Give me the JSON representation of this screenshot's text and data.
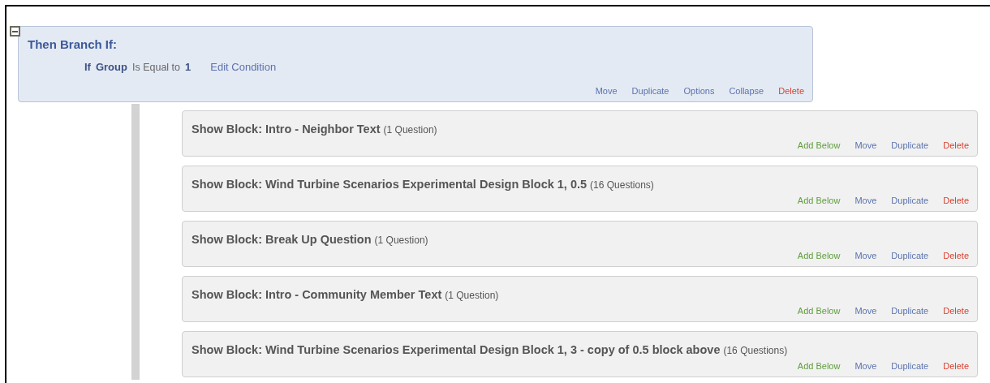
{
  "branch": {
    "expanded": true,
    "title": "Then Branch If:",
    "condition": {
      "keyword": "If",
      "field": "Group",
      "operator": "Is Equal to",
      "value": "1",
      "edit": "Edit Condition"
    },
    "actions": [
      {
        "label": "Move",
        "kind": "link"
      },
      {
        "label": "Duplicate",
        "kind": "link"
      },
      {
        "label": "Options",
        "kind": "link"
      },
      {
        "label": "Collapse",
        "kind": "link"
      },
      {
        "label": "Delete",
        "kind": "delete"
      }
    ]
  },
  "blocks": [
    {
      "title": "Show Block: Intro - Neighbor Text",
      "count": "(1 Question)",
      "actions": [
        {
          "label": "Add Below",
          "kind": "add"
        },
        {
          "label": "Move",
          "kind": "link"
        },
        {
          "label": "Duplicate",
          "kind": "link"
        },
        {
          "label": "Delete",
          "kind": "delete"
        }
      ]
    },
    {
      "title": "Show Block: Wind Turbine Scenarios Experimental Design Block 1, 0.5",
      "count": "(16 Questions)",
      "actions": [
        {
          "label": "Add Below",
          "kind": "add"
        },
        {
          "label": "Move",
          "kind": "link"
        },
        {
          "label": "Duplicate",
          "kind": "link"
        },
        {
          "label": "Delete",
          "kind": "delete"
        }
      ]
    },
    {
      "title": "Show Block: Break Up Question",
      "count": "(1 Question)",
      "actions": [
        {
          "label": "Add Below",
          "kind": "add"
        },
        {
          "label": "Move",
          "kind": "link"
        },
        {
          "label": "Duplicate",
          "kind": "link"
        },
        {
          "label": "Delete",
          "kind": "delete"
        }
      ]
    },
    {
      "title": "Show Block: Intro - Community Member Text",
      "count": "(1 Question)",
      "actions": [
        {
          "label": "Add Below",
          "kind": "add"
        },
        {
          "label": "Move",
          "kind": "link"
        },
        {
          "label": "Duplicate",
          "kind": "link"
        },
        {
          "label": "Delete",
          "kind": "delete"
        }
      ]
    },
    {
      "title": "Show Block: Wind Turbine Scenarios Experimental Design Block 1, 3 - copy of 0.5 block above",
      "count": "(16 Questions)",
      "actions": [
        {
          "label": "Add Below",
          "kind": "add"
        },
        {
          "label": "Move",
          "kind": "link"
        },
        {
          "label": "Duplicate",
          "kind": "link"
        },
        {
          "label": "Delete",
          "kind": "delete"
        }
      ]
    }
  ]
}
